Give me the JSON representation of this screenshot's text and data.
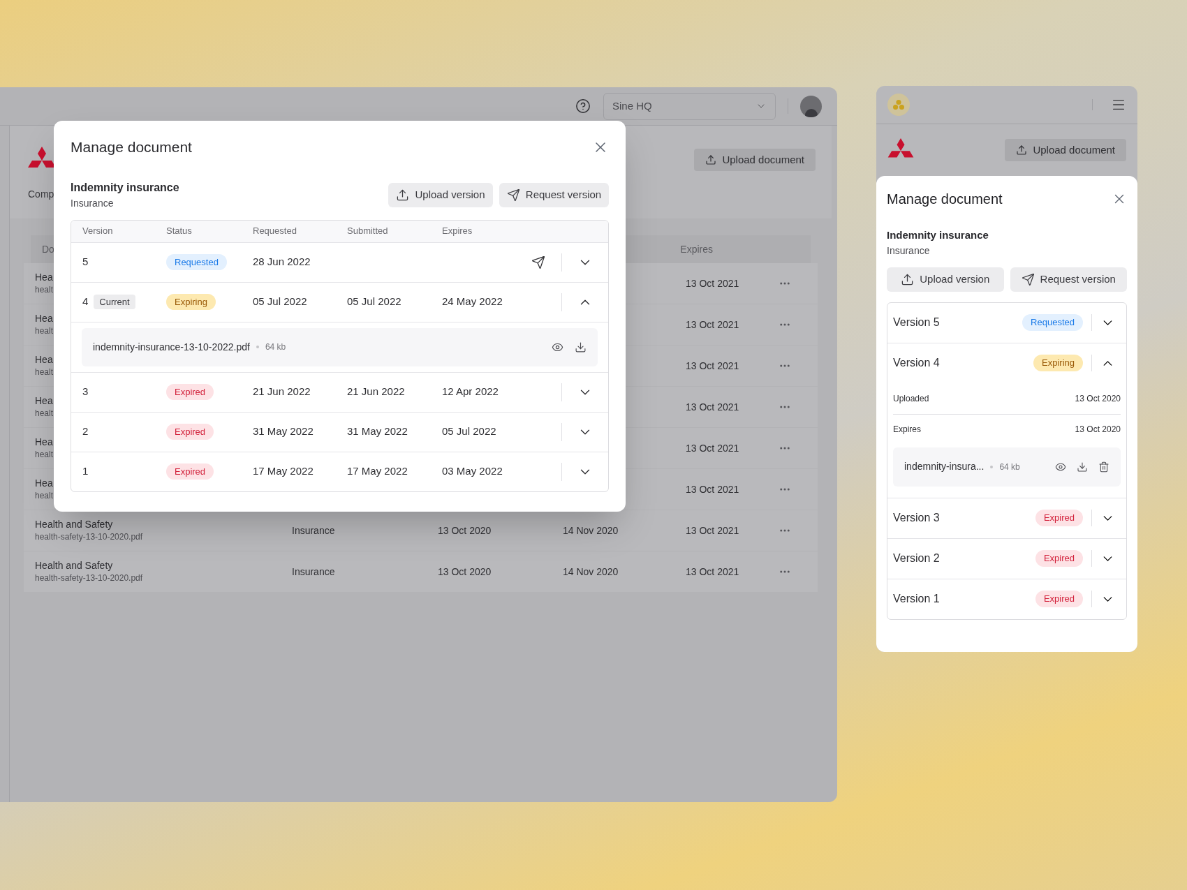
{
  "desktop": {
    "header": {
      "workspace_select": "Sine HQ"
    },
    "page": {
      "section_label": "Comp",
      "upload_button": "Upload document",
      "table": {
        "first_header": "Do",
        "expires_header": "Expires",
        "rows": [
          {
            "name": "Hea",
            "file": "healt",
            "expires": "13 Oct 2021"
          },
          {
            "name": "Hea",
            "file": "healt",
            "expires": "13 Oct 2021"
          },
          {
            "name": "Hea",
            "file": "healt",
            "expires": "13 Oct 2021"
          },
          {
            "name": "Hea",
            "file": "healt",
            "expires": "13 Oct 2021"
          },
          {
            "name": "Hea",
            "file": "healt",
            "expires": "13 Oct 2021"
          },
          {
            "name": "Hea",
            "file": "healt",
            "expires": "13 Oct 2021"
          },
          {
            "name": "Health and Safety",
            "file": "health-safety-13-10-2020.pdf",
            "category": "Insurance",
            "column_3": "13 Oct 2020",
            "column_4": "14 Nov 2020",
            "expires": "13 Oct 2021"
          },
          {
            "name": "Health and Safety",
            "file": "health-safety-13-10-2020.pdf",
            "category": "Insurance",
            "column_3": "13 Oct 2020",
            "column_4": "14 Nov 2020",
            "expires": "13 Oct 2021"
          }
        ]
      }
    },
    "modal": {
      "title": "Manage document",
      "document": {
        "name": "Indemnity insurance",
        "category": "Insurance"
      },
      "buttons": [
        {
          "kind": "upload",
          "label": "Upload version"
        },
        {
          "kind": "request",
          "label": "Request version"
        }
      ],
      "columns": [
        "Version",
        "Status",
        "Requested",
        "Submitted",
        "Expires"
      ],
      "versions": [
        {
          "number": "5",
          "status": {
            "kind": "requested",
            "label": "Requested"
          },
          "requested": "28 Jun 2022",
          "can_send": true,
          "expanded": false
        },
        {
          "number": "4",
          "tag": "Current",
          "status": {
            "kind": "expiring",
            "label": "Expiring"
          },
          "requested": "05 Jul 2022",
          "submitted": "05 Jul 2022",
          "expires": "24 May 2022",
          "can_send": false,
          "expanded": true,
          "file": {
            "name": "indemnity-insurance-13-10-2022.pdf",
            "size": "64 kb"
          }
        },
        {
          "number": "3",
          "status": {
            "kind": "expired",
            "label": "Expired"
          },
          "requested": "21 Jun 2022",
          "submitted": "21 Jun 2022",
          "expires": "12 Apr 2022",
          "can_send": false,
          "expanded": false
        },
        {
          "number": "2",
          "status": {
            "kind": "expired",
            "label": "Expired"
          },
          "requested": "31 May 2022",
          "submitted": "31 May 2022",
          "expires": "05 Jul 2022",
          "can_send": false,
          "expanded": false
        },
        {
          "number": "1",
          "status": {
            "kind": "expired",
            "label": "Expired"
          },
          "requested": "17 May 2022",
          "submitted": "17 May 2022",
          "expires": "03 May 2022",
          "can_send": false,
          "expanded": false
        }
      ]
    }
  },
  "mobile": {
    "page": {
      "upload_button": "Upload document"
    },
    "modal": {
      "title": "Manage document",
      "document": {
        "name": "Indemnity insurance",
        "category": "Insurance"
      },
      "buttons": [
        {
          "kind": "upload",
          "label": "Upload version"
        },
        {
          "kind": "request",
          "label": "Request version"
        }
      ],
      "versions": [
        {
          "label": "Version 5",
          "status": {
            "kind": "requested",
            "label": "Requested"
          },
          "expanded": false
        },
        {
          "label": "Version 4",
          "status": {
            "kind": "expiring",
            "label": "Expiring"
          },
          "expanded": true,
          "details": [
            {
              "label": "Uploaded",
              "value": "13 Oct 2020"
            },
            {
              "label": "Expires",
              "value": "13 Oct 2020"
            }
          ],
          "file": {
            "name": "indemnity-insura...",
            "size": "64 kb"
          }
        },
        {
          "label": "Version 3",
          "status": {
            "kind": "expired",
            "label": "Expired"
          },
          "expanded": false
        },
        {
          "label": "Version 2",
          "status": {
            "kind": "expired",
            "label": "Expired"
          },
          "expanded": false
        },
        {
          "label": "Version 1",
          "status": {
            "kind": "expired",
            "label": "Expired"
          },
          "expanded": false
        }
      ]
    }
  }
}
